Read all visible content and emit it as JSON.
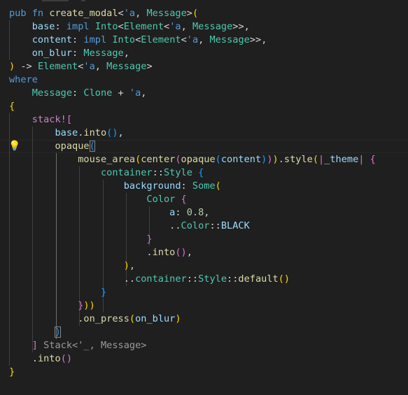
{
  "theme": {
    "background": "#1f1f1f",
    "keyword": "#569cd6",
    "function": "#dcdcaa",
    "type": "#4ec9b0",
    "variable": "#9cdcfe",
    "macro_keyword": "#c586c0",
    "number": "#b5cea8",
    "bracket_level_1": "#ffd700",
    "bracket_level_2": "#da70d6",
    "bracket_level_3": "#179fff",
    "inlay_hint": "#9b9b9b"
  },
  "gutter": {
    "lightbulb_icon": "lightbulb-icon"
  },
  "lines": [
    [
      [
        "kw",
        "pub"
      ],
      [
        "pn",
        " "
      ],
      [
        "kw",
        "fn"
      ],
      [
        "pn",
        " "
      ],
      [
        "fn",
        "create_modal"
      ],
      [
        "pn",
        "<"
      ],
      [
        "lt",
        "'a"
      ],
      [
        "pn",
        ", "
      ],
      [
        "ty",
        "Message"
      ],
      [
        "pn",
        ">"
      ],
      [
        "b1",
        "("
      ]
    ],
    [
      [
        "pn",
        "    "
      ],
      [
        "var",
        "base"
      ],
      [
        "pn",
        ": "
      ],
      [
        "kw",
        "impl"
      ],
      [
        "pn",
        " "
      ],
      [
        "ty",
        "Into"
      ],
      [
        "pn",
        "<"
      ],
      [
        "ty",
        "Element"
      ],
      [
        "pn",
        "<"
      ],
      [
        "lt",
        "'a"
      ],
      [
        "pn",
        ", "
      ],
      [
        "ty",
        "Message"
      ],
      [
        "pn",
        ">>,"
      ]
    ],
    [
      [
        "pn",
        "    "
      ],
      [
        "var",
        "content"
      ],
      [
        "pn",
        ": "
      ],
      [
        "kw",
        "impl"
      ],
      [
        "pn",
        " "
      ],
      [
        "ty",
        "Into"
      ],
      [
        "pn",
        "<"
      ],
      [
        "ty",
        "Element"
      ],
      [
        "pn",
        "<"
      ],
      [
        "lt",
        "'a"
      ],
      [
        "pn",
        ", "
      ],
      [
        "ty",
        "Message"
      ],
      [
        "pn",
        ">>,"
      ]
    ],
    [
      [
        "pn",
        "    "
      ],
      [
        "var",
        "on_blur"
      ],
      [
        "pn",
        ": "
      ],
      [
        "ty",
        "Message"
      ],
      [
        "pn",
        ","
      ]
    ],
    [
      [
        "b1",
        ")"
      ],
      [
        "pn",
        " "
      ],
      [
        "op",
        "->"
      ],
      [
        "pn",
        " "
      ],
      [
        "ty",
        "Element"
      ],
      [
        "pn",
        "<"
      ],
      [
        "lt",
        "'a"
      ],
      [
        "pn",
        ", "
      ],
      [
        "ty",
        "Message"
      ],
      [
        "pn",
        ">"
      ]
    ],
    [
      [
        "kw",
        "where"
      ]
    ],
    [
      [
        "pn",
        "    "
      ],
      [
        "ty",
        "Message"
      ],
      [
        "pn",
        ": "
      ],
      [
        "ty",
        "Clone"
      ],
      [
        "pn",
        " "
      ],
      [
        "op",
        "+"
      ],
      [
        "pn",
        " "
      ],
      [
        "lt",
        "'a"
      ],
      [
        "pn",
        ","
      ]
    ],
    [
      [
        "b1",
        "{"
      ]
    ],
    [
      [
        "pn",
        "    "
      ],
      [
        "ctl",
        "stack!"
      ],
      [
        "b2",
        "["
      ]
    ],
    [
      [
        "pn",
        "        "
      ],
      [
        "var",
        "base"
      ],
      [
        "pn",
        "."
      ],
      [
        "fn",
        "into"
      ],
      [
        "b3",
        "()"
      ],
      [
        "pn",
        ","
      ]
    ],
    [
      [
        "pn",
        "        "
      ],
      [
        "fn",
        "opaque"
      ],
      [
        "b3 bracket-match",
        "("
      ]
    ],
    [
      [
        "pn",
        "            "
      ],
      [
        "fn",
        "mouse_area"
      ],
      [
        "b1",
        "("
      ],
      [
        "fn",
        "center"
      ],
      [
        "b2",
        "("
      ],
      [
        "fn",
        "opaque"
      ],
      [
        "b3",
        "("
      ],
      [
        "var",
        "content"
      ],
      [
        "b3",
        ")"
      ],
      [
        "b2",
        ")"
      ],
      [
        "b1",
        ")"
      ],
      [
        "pn",
        "."
      ],
      [
        "fn",
        "style"
      ],
      [
        "b1",
        "("
      ],
      [
        "b2",
        "|"
      ],
      [
        "var",
        "_theme"
      ],
      [
        "b2",
        "|"
      ],
      [
        "pn",
        " "
      ],
      [
        "b2",
        "{"
      ]
    ],
    [
      [
        "pn",
        "                "
      ],
      [
        "ty",
        "container"
      ],
      [
        "pn",
        "::"
      ],
      [
        "ty",
        "Style"
      ],
      [
        "pn",
        " "
      ],
      [
        "b3",
        "{"
      ]
    ],
    [
      [
        "pn",
        "                    "
      ],
      [
        "var",
        "background"
      ],
      [
        "pn",
        ": "
      ],
      [
        "ty",
        "Some"
      ],
      [
        "b1",
        "("
      ]
    ],
    [
      [
        "pn",
        "                        "
      ],
      [
        "ty",
        "Color"
      ],
      [
        "pn",
        " "
      ],
      [
        "b2",
        "{"
      ]
    ],
    [
      [
        "pn",
        "                            "
      ],
      [
        "var",
        "a"
      ],
      [
        "pn",
        ": "
      ],
      [
        "num",
        "0.8"
      ],
      [
        "pn",
        ","
      ]
    ],
    [
      [
        "pn",
        "                            "
      ],
      [
        "pn",
        ".."
      ],
      [
        "ty",
        "Color"
      ],
      [
        "pn",
        "::"
      ],
      [
        "var",
        "BLACK"
      ]
    ],
    [
      [
        "pn",
        "                        "
      ],
      [
        "b2",
        "}"
      ]
    ],
    [
      [
        "pn",
        "                        "
      ],
      [
        "pn",
        "."
      ],
      [
        "fn",
        "into"
      ],
      [
        "b2",
        "()"
      ],
      [
        "pn",
        ","
      ]
    ],
    [
      [
        "pn",
        "                    "
      ],
      [
        "b1",
        ")"
      ],
      [
        "pn",
        ","
      ]
    ],
    [
      [
        "pn",
        "                    "
      ],
      [
        "pn",
        ".."
      ],
      [
        "ty",
        "container"
      ],
      [
        "pn",
        "::"
      ],
      [
        "ty",
        "Style"
      ],
      [
        "pn",
        "::"
      ],
      [
        "fn",
        "default"
      ],
      [
        "b1",
        "()"
      ]
    ],
    [
      [
        "pn",
        "                "
      ],
      [
        "b3",
        "}"
      ]
    ],
    [
      [
        "pn",
        "            "
      ],
      [
        "b2",
        "}"
      ],
      [
        "b1",
        "))"
      ]
    ],
    [
      [
        "pn",
        "            "
      ],
      [
        "pn",
        "."
      ],
      [
        "fn",
        "on_press"
      ],
      [
        "b1",
        "("
      ],
      [
        "var",
        "on_blur"
      ],
      [
        "b1",
        ")"
      ]
    ],
    [
      [
        "pn",
        "        "
      ],
      [
        "b3 bracket-match",
        ")"
      ]
    ],
    [
      [
        "pn",
        "    "
      ],
      [
        "b2",
        "]"
      ],
      [
        "hint",
        " Stack<'_, Message>"
      ]
    ],
    [
      [
        "pn",
        "    "
      ],
      [
        "pn",
        "."
      ],
      [
        "fn",
        "into"
      ],
      [
        "b2",
        "()"
      ]
    ],
    [
      [
        "b1",
        "}"
      ]
    ]
  ]
}
